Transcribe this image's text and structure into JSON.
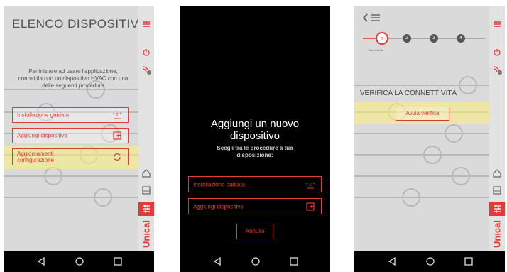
{
  "screen1": {
    "title": "ELENCO DISPOSITIVI",
    "intro": "Per iniziare ad usare l'applicazione, connettila con un dispositivo HVAC con una delle seguenti procedure",
    "buttons": [
      {
        "label": "Installazione guidata",
        "icon": "guided-install-icon"
      },
      {
        "label": "Aggiungi dispositivo",
        "icon": "add-device-icon"
      },
      {
        "label": "Aggiornamenti configurazione",
        "line1": "Aggiornamenti",
        "line2": "configurazione",
        "icon": "refresh-icon"
      }
    ],
    "brand": "Unical"
  },
  "screen2": {
    "title_line1": "Aggiungi un nuovo",
    "title_line2": "dispositivo",
    "subtitle_line1": "Scegli tra le procedure a tua",
    "subtitle_line2": "disposizione:",
    "buttons": [
      {
        "label": "Installazione guidata",
        "icon": "guided-install-icon"
      },
      {
        "label": "Aggiungi dispositivo",
        "icon": "add-device-icon"
      }
    ],
    "cancel": "Annulla"
  },
  "screen3": {
    "steps": [
      "1",
      "2",
      "3",
      "4"
    ],
    "step_label": "Connettività",
    "heading": "VERIFICA LA CONNETTIVITÀ",
    "verify_button": "Avvia verifica",
    "brand": "Unical"
  },
  "colors": {
    "accent": "#e53935",
    "highlight": "#fff078"
  }
}
